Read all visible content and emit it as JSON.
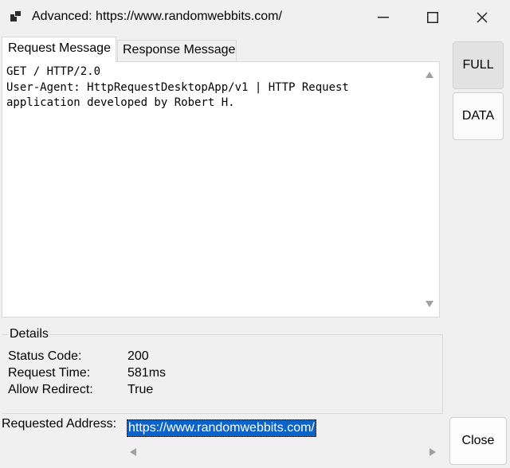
{
  "window": {
    "title": "Advanced: https://www.randomwebbits.com/",
    "icon": "app-icon",
    "controls": [
      "minimize-icon",
      "maximize-icon",
      "close-icon"
    ]
  },
  "tabs": [
    {
      "label": "Request Message",
      "selected": true
    },
    {
      "label": "Response Message",
      "selected": false
    }
  ],
  "request": {
    "text": "GET / HTTP/2.0\nUser-Agent: HttpRequestDesktopApp/v1 | HTTP Request\napplication developed by Robert H."
  },
  "side_buttons": {
    "full": "FULL",
    "data": "DATA",
    "close": "Close"
  },
  "details": {
    "title": "Details",
    "rows": [
      {
        "label": "Status Code:",
        "value": "200"
      },
      {
        "label": "Request Time:",
        "value": "581ms"
      },
      {
        "label": "Allow Redirect:",
        "value": "True"
      }
    ]
  },
  "address": {
    "label": "Requested Address:",
    "value": "https://www.randomwebbits.com/"
  },
  "colors": {
    "background": "#f0f0f0",
    "selection": "#0a63c8",
    "panel": "#ffffff"
  }
}
